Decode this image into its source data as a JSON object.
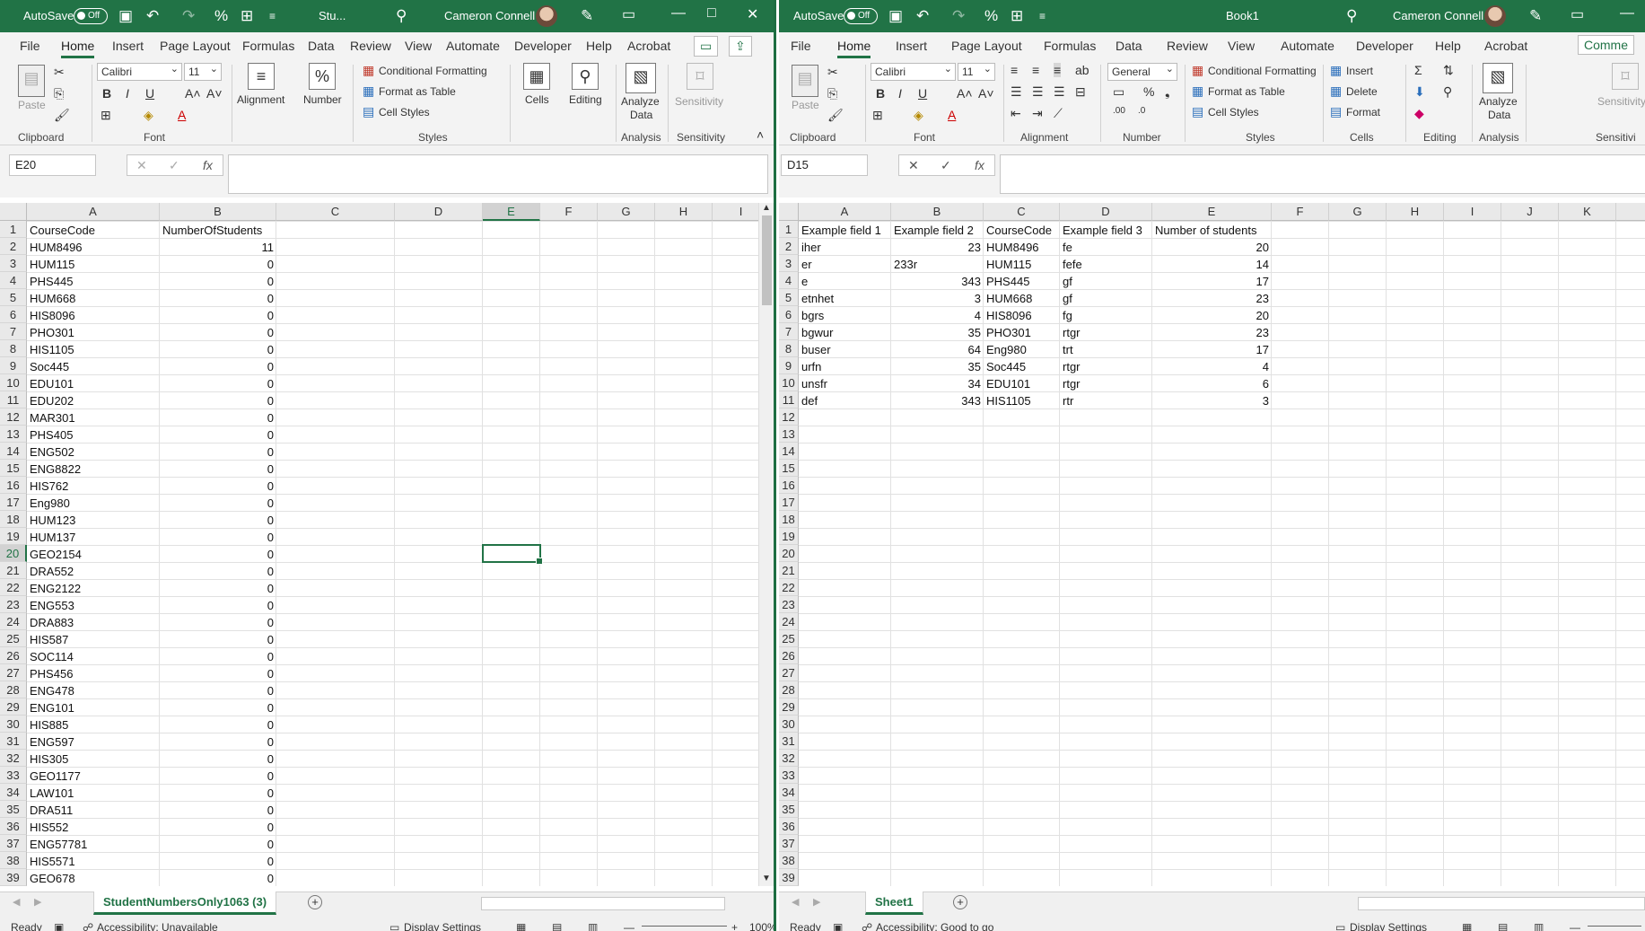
{
  "left": {
    "title": {
      "autosave": "AutoSave",
      "toggle": "Off",
      "filename": "Stu...",
      "user": "Cameron Connell"
    },
    "tabs": [
      "File",
      "Home",
      "Insert",
      "Page Layout",
      "Formulas",
      "Data",
      "Review",
      "View",
      "Automate",
      "Developer",
      "Help",
      "Acrobat"
    ],
    "ribbon": {
      "paste": "Paste",
      "font_name": "Calibri",
      "font_size": "11",
      "alignment": "Alignment",
      "number": "Number",
      "cond_format": "Conditional Formatting",
      "format_table": "Format as Table",
      "cell_styles": "Cell Styles",
      "cells": "Cells",
      "editing": "Editing",
      "analyze1": "Analyze",
      "analyze2": "Data",
      "sensitivity": "Sensitivity",
      "groups": {
        "clipboard": "Clipboard",
        "font": "Font",
        "styles": "Styles",
        "analysis": "Analysis",
        "sensitivity": "Sensitivity"
      }
    },
    "namebox": "E20",
    "columns": [
      "A",
      "B",
      "C",
      "D",
      "E",
      "F",
      "G",
      "H",
      "I"
    ],
    "rows": [
      [
        "CourseCode",
        "NumberOfStudents"
      ],
      [
        "HUM8496",
        "11"
      ],
      [
        "HUM115",
        "0"
      ],
      [
        "PHS445",
        "0"
      ],
      [
        "HUM668",
        "0"
      ],
      [
        "HIS8096",
        "0"
      ],
      [
        "PHO301",
        "0"
      ],
      [
        "HIS1105",
        "0"
      ],
      [
        "Soc445",
        "0"
      ],
      [
        "EDU101",
        "0"
      ],
      [
        "EDU202",
        "0"
      ],
      [
        "MAR301",
        "0"
      ],
      [
        "PHS405",
        "0"
      ],
      [
        "ENG502",
        "0"
      ],
      [
        "ENG8822",
        "0"
      ],
      [
        "HIS762",
        "0"
      ],
      [
        "Eng980",
        "0"
      ],
      [
        "HUM123",
        "0"
      ],
      [
        "HUM137",
        "0"
      ],
      [
        "GEO2154",
        "0"
      ],
      [
        "DRA552",
        "0"
      ],
      [
        "ENG2122",
        "0"
      ],
      [
        "ENG553",
        "0"
      ],
      [
        "DRA883",
        "0"
      ],
      [
        "HIS587",
        "0"
      ],
      [
        "SOC114",
        "0"
      ],
      [
        "PHS456",
        "0"
      ],
      [
        "ENG478",
        "0"
      ],
      [
        "ENG101",
        "0"
      ],
      [
        "HIS885",
        "0"
      ],
      [
        "ENG597",
        "0"
      ],
      [
        "HIS305",
        "0"
      ],
      [
        "GEO1177",
        "0"
      ],
      [
        "LAW101",
        "0"
      ],
      [
        "DRA511",
        "0"
      ],
      [
        "HIS552",
        "0"
      ],
      [
        "ENG57781",
        "0"
      ],
      [
        "HIS5571",
        "0"
      ],
      [
        "GEO678",
        "0"
      ]
    ],
    "sheet_tab": "StudentNumbersOnly1063 (3)",
    "status": {
      "ready": "Ready",
      "accessibility": "Accessibility: Unavailable",
      "display": "Display Settings",
      "zoom": "100%"
    }
  },
  "right": {
    "title": {
      "autosave": "AutoSave",
      "toggle": "Off",
      "filename": "Book1",
      "user": "Cameron Connell"
    },
    "tabs": [
      "File",
      "Home",
      "Insert",
      "Page Layout",
      "Formulas",
      "Data",
      "Review",
      "View",
      "Automate",
      "Developer",
      "Help",
      "Acrobat",
      "Comme"
    ],
    "ribbon": {
      "paste": "Paste",
      "font_name": "Calibri",
      "font_size": "11",
      "number_format": "General",
      "cond_format": "Conditional Formatting",
      "format_table": "Format as Table",
      "cell_styles": "Cell Styles",
      "insert": "Insert",
      "delete": "Delete",
      "format": "Format",
      "analyze1": "Analyze",
      "analyze2": "Data",
      "sensitivity": "Sensitivity",
      "groups": {
        "clipboard": "Clipboard",
        "font": "Font",
        "alignment": "Alignment",
        "number": "Number",
        "styles": "Styles",
        "cells": "Cells",
        "editing": "Editing",
        "analysis": "Analysis",
        "sensitivity": "Sensitivi"
      }
    },
    "namebox": "D15",
    "columns": [
      "A",
      "B",
      "C",
      "D",
      "E",
      "F",
      "G",
      "H",
      "I",
      "J",
      "K"
    ],
    "rows": [
      [
        "Example field 1",
        "Example field 2",
        "CourseCode",
        "Example field 3",
        "Number of students"
      ],
      [
        "iher",
        "23",
        "HUM8496",
        "fe",
        "20"
      ],
      [
        "er",
        "233r",
        "HUM115",
        "fefe",
        "14"
      ],
      [
        "e",
        "343",
        "PHS445",
        "gf",
        "17"
      ],
      [
        "etnhet",
        "3",
        "HUM668",
        "gf",
        "23"
      ],
      [
        "bgrs",
        "4",
        "HIS8096",
        "fg",
        "20"
      ],
      [
        "bgwur",
        "35",
        "PHO301",
        "rtgr",
        "23"
      ],
      [
        "buser",
        "64",
        "Eng980",
        "trt",
        "17"
      ],
      [
        "urfn",
        "35",
        "Soc445",
        "rtgr",
        "4"
      ],
      [
        "unsfr",
        "34",
        "EDU101",
        "rtgr",
        "6"
      ],
      [
        "def",
        "343",
        "HIS1105",
        "rtr",
        "3"
      ]
    ],
    "row_count": 39,
    "sheet_tab": "Sheet1",
    "status": {
      "ready": "Ready",
      "accessibility": "Accessibility: Good to go",
      "display": "Display Settings"
    }
  }
}
